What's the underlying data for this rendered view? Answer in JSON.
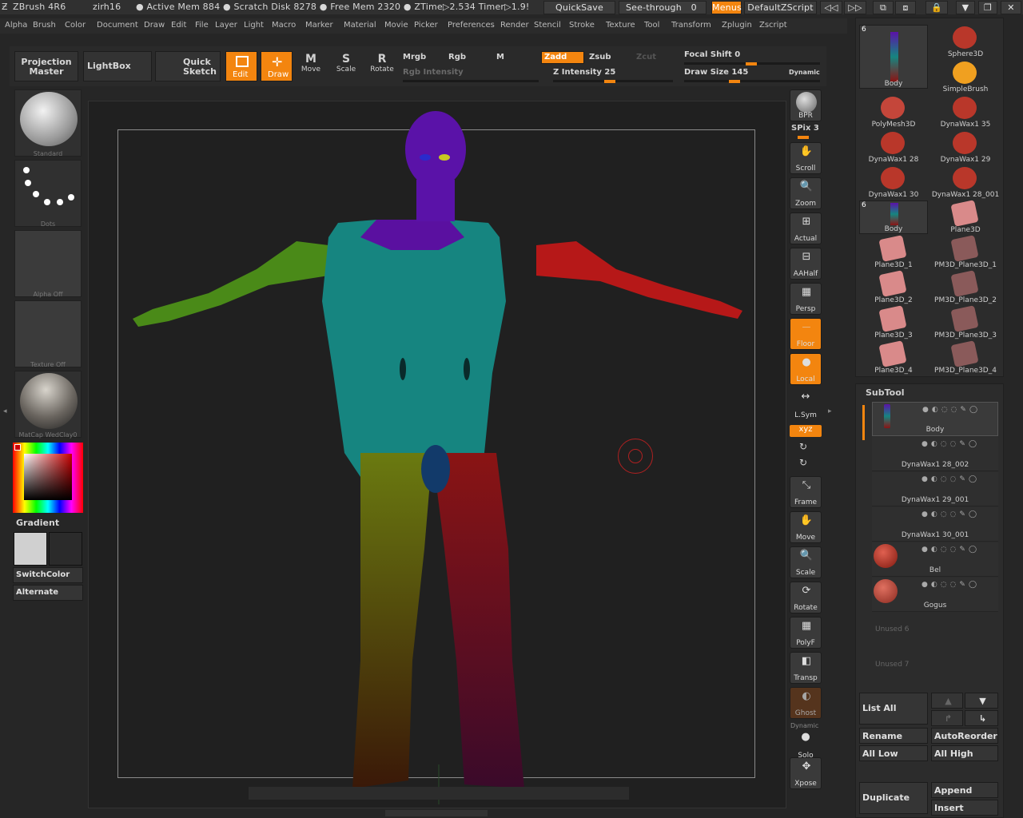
{
  "titlebar": {
    "app": "ZBrush 4R6",
    "user": "zirh16",
    "stats": "● Active Mem 884 ● Scratch Disk 8278 ● Free Mem 2320 ● ZTime▷2.534 Timer▷1.9!",
    "quicksave": "QuickSave",
    "seethrough": "See-through",
    "seethrough_val": "0",
    "menus": "Menus",
    "script": "DefaultZScript"
  },
  "menus": [
    "Alpha",
    "Brush",
    "Color",
    "Document",
    "Draw",
    "Edit",
    "File",
    "Layer",
    "Light",
    "Macro",
    "Marker",
    "Material",
    "Movie",
    "Picker",
    "Preferences",
    "Render",
    "Stencil",
    "Stroke",
    "Texture",
    "Tool",
    "Transform",
    "Zplugin",
    "Zscript"
  ],
  "toolbar": {
    "projection": "Projection Master",
    "lightbox": "LightBox",
    "quicksketch": "Quick Sketch",
    "edit": "Edit",
    "draw": "Draw",
    "move": "Move",
    "scale": "Scale",
    "rotate": "Rotate",
    "mrgb": "Mrgb",
    "rgb": "Rgb",
    "m": "M",
    "rgb_intensity": "Rgb Intensity",
    "zadd": "Zadd",
    "zsub": "Zsub",
    "zcut": "Zcut",
    "z_intensity": "Z Intensity 25",
    "focal_shift": "Focal Shift 0",
    "draw_size": "Draw Size 145",
    "dynamic": "Dynamic"
  },
  "left": {
    "brush": "Standard",
    "stroke": "Dots",
    "alpha": "Alpha Off",
    "texture": "Texture Off",
    "material": "MatCap WedClay0",
    "gradient": "Gradient",
    "switchcolor": "SwitchColor",
    "alternate": "Alternate"
  },
  "right": {
    "bpr": "BPR",
    "spix": "SPix 3",
    "scroll": "Scroll",
    "zoom": "Zoom",
    "actual": "Actual",
    "aahalf": "AAHalf",
    "persp": "Persp",
    "floor": "Floor",
    "local": "Local",
    "lsym": "L.Sym",
    "xyz": "xyz",
    "frame": "Frame",
    "move": "Move",
    "scale": "Scale",
    "rotate": "Rotate",
    "polyf": "PolyF",
    "transp": "Transp",
    "ghost": "Ghost",
    "dynamic": "Dynamic",
    "solo": "Solo",
    "xpose": "Xpose"
  },
  "tools": [
    {
      "name": "Body",
      "count": "6",
      "color": "#2a2a2a"
    },
    {
      "name": "Sphere3D",
      "color": "#b9372a"
    },
    {
      "name": "SimpleBrush",
      "color": "#f0a020"
    },
    {
      "name": "PolyMesh3D",
      "color": "#c4463a"
    },
    {
      "name": "DynaWax1 35",
      "color": "#b9372a"
    },
    {
      "name": "DynaWax1 28",
      "color": "#b9372a"
    },
    {
      "name": "DynaWax1 29",
      "color": "#b9372a"
    },
    {
      "name": "DynaWax1 30",
      "color": "#b9372a"
    },
    {
      "name": "DynaWax1 28_001",
      "color": "#b9372a"
    },
    {
      "name": "Body",
      "count": "6",
      "color": "#2a2a2a"
    },
    {
      "name": "Plane3D",
      "color": "#d98a8a"
    },
    {
      "name": "Plane3D_1",
      "color": "#d98a8a"
    },
    {
      "name": "PM3D_Plane3D_1",
      "color": "#8a5a5a"
    },
    {
      "name": "Plane3D_2",
      "color": "#d98a8a"
    },
    {
      "name": "PM3D_Plane3D_2",
      "color": "#8a5a5a"
    },
    {
      "name": "Plane3D_3",
      "color": "#d98a8a"
    },
    {
      "name": "PM3D_Plane3D_3",
      "color": "#8a5a5a"
    },
    {
      "name": "Plane3D_4",
      "color": "#d98a8a"
    },
    {
      "name": "PM3D_Plane3D_4",
      "color": "#8a5a5a"
    }
  ],
  "subtool": {
    "title": "SubTool",
    "items": [
      "Body",
      "DynaWax1 28_002",
      "DynaWax1 29_001",
      "DynaWax1 30_001",
      "Bel",
      "Gogus"
    ],
    "unused": [
      "Unused 6",
      "Unused 7"
    ],
    "listall": "List All",
    "rename": "Rename",
    "autoreorder": "AutoReorder",
    "alllow": "All Low",
    "allhigh": "All High",
    "duplicate": "Duplicate",
    "append": "Append",
    "insert": "Insert"
  }
}
